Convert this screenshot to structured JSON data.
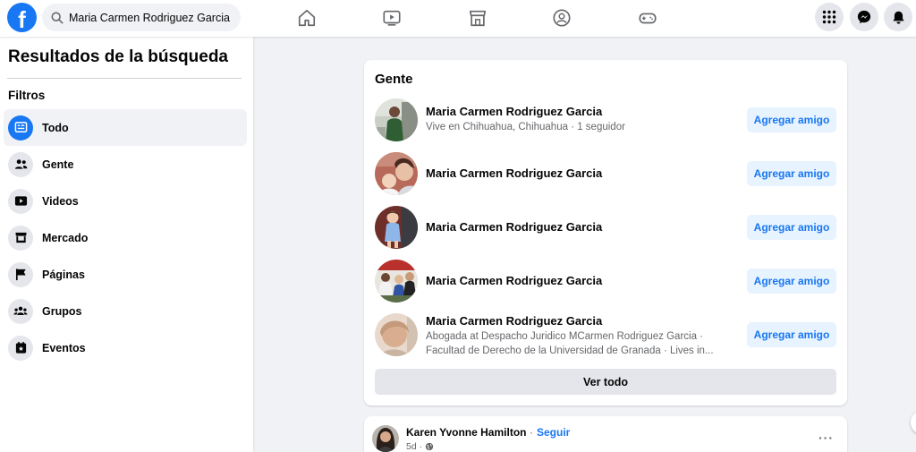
{
  "topbar": {
    "logo_letter": "f",
    "search_value": "Maria Carmen Rodriguez Garcia",
    "nav_icons": [
      "home-icon",
      "video-icon",
      "marketplace-icon",
      "groups-icon",
      "gaming-icon"
    ],
    "right_icons": [
      "menu-grid-icon",
      "messenger-icon",
      "bell-icon"
    ]
  },
  "sidebar": {
    "title": "Resultados de la búsqueda",
    "filters_label": "Filtros",
    "items": [
      {
        "label": "Todo",
        "icon": "all-results-icon",
        "active": true
      },
      {
        "label": "Gente",
        "icon": "people-icon",
        "active": false
      },
      {
        "label": "Videos",
        "icon": "video-icon",
        "active": false
      },
      {
        "label": "Mercado",
        "icon": "store-icon",
        "active": false
      },
      {
        "label": "Páginas",
        "icon": "flag-icon",
        "active": false
      },
      {
        "label": "Grupos",
        "icon": "groups-icon",
        "active": false
      },
      {
        "label": "Eventos",
        "icon": "calendar-star-icon",
        "active": false
      }
    ]
  },
  "people": {
    "title": "Gente",
    "add_label": "Agregar amigo",
    "see_all_label": "Ver todo",
    "results": [
      {
        "name": "Maria Carmen Rodriguez Garcia",
        "meta": [
          "Vive en Chihuahua, Chihuahua · 1 seguidor"
        ]
      },
      {
        "name": "Maria Carmen Rodriguez Garcia",
        "meta": []
      },
      {
        "name": "Maria Carmen Rodriguez Garcia",
        "meta": []
      },
      {
        "name": "Maria Carmen Rodriguez Garcia",
        "meta": []
      },
      {
        "name": "Maria Carmen Rodriguez Garcia",
        "meta": [
          "Abogada at Despacho Juridico MCarmen Rodriguez Garcia ·",
          "Facultad de Derecho de la Universidad de Granada · Lives in..."
        ]
      }
    ]
  },
  "post": {
    "author": "Karen Yvonne Hamilton",
    "separator": "·",
    "follow_label": "Seguir",
    "time": "5d ·",
    "more": "···"
  },
  "colors": {
    "brand": "#1877f2",
    "background": "#f0f2f5",
    "button_light": "#e7f3ff",
    "secondary_text": "#65676b"
  }
}
